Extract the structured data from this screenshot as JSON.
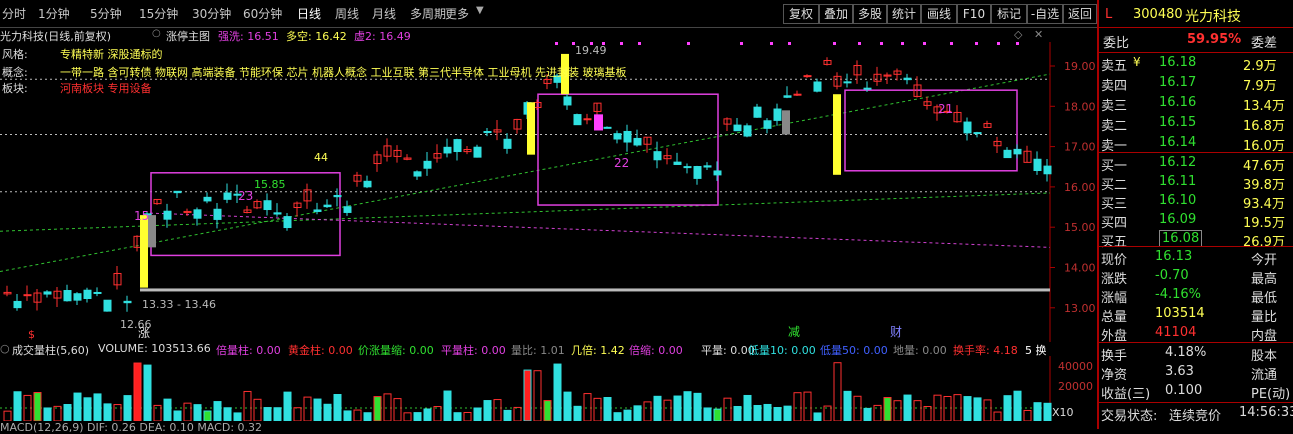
{
  "toolbar": {
    "periods": [
      "分时",
      "1分钟",
      "5分钟",
      "15分钟",
      "30分钟",
      "60分钟",
      "日线",
      "周线",
      "月线",
      "多周期",
      "更多"
    ],
    "active_period": "日线",
    "buttons": [
      "复权",
      "叠加",
      "多股",
      "统计",
      "画线",
      "F10",
      "标记",
      "-自选",
      "返回"
    ]
  },
  "chart_header": {
    "stock": "光力科技(日线,前复权)",
    "indicator": "涨停主图",
    "qiang": "强洗: 16.51",
    "duokong": "多空: 16.42",
    "xu": "虚2: 16.49"
  },
  "stock_info": {
    "style_label": "风格:",
    "style_value": "专精特新 深股通标的",
    "concept_label": "概念:",
    "concept_value": "一带一路 含可转债 物联网 高端装备 节能环保 芯片 机器人概念 工业互联 第三代半导体 工业母机 先进封装 玻璃基板",
    "sector_label": "板块:",
    "sector_value": "河南板块 专用设备"
  },
  "annotations": {
    "high_label": "19.49",
    "range_label": "13.33 - 13.46",
    "low_label": "12.66",
    "num_44": "44",
    "num_23": "23",
    "num_22": "22",
    "num_21": "21",
    "num_15": "15",
    "price_1585": "15.85",
    "mark_s": "$",
    "mark_zhang": "涨",
    "mark_jian": "减",
    "mark_cai": "财"
  },
  "y_axis": [
    "19.00",
    "18.00",
    "17.00",
    "16.00",
    "15.00",
    "14.00",
    "13.00"
  ],
  "volume_header": {
    "name": "成交量柱(5,60)",
    "volume": "VOLUME: 103513.66",
    "beiliang": "倍量柱: 0.00",
    "huangjin": "黄金柱: 0.00",
    "jiazhang": "价涨量缩: 0.00",
    "pingliang": "平量柱: 0.00",
    "liangbi": "量比: 1.01",
    "jibei": "几倍: 1.42",
    "beisuo": "倍缩: 0.00",
    "pingliang2": "平量: 0.00",
    "diliang10": "低量10: 0.00",
    "diliang50": "低量50: 0.00",
    "diliang": "地量: 0.00",
    "huanshou": "换手率: 4.18",
    "five": "5 换"
  },
  "vol_axis": [
    "40000",
    "20000"
  ],
  "vol_unit": "X10",
  "macd_line": "MACD(12,26,9)  DIF: 0.26  DEA: 0.10  MACD: 0.32",
  "quote": {
    "l": "L",
    "code": "300480",
    "name": "光力科技",
    "weibi_label": "委比",
    "weibi_value": "59.95%",
    "weicha_label": "委差",
    "asks": [
      {
        "label": "卖五",
        "price": "16.18",
        "vol": "2.9万"
      },
      {
        "label": "卖四",
        "price": "16.17",
        "vol": "7.9万"
      },
      {
        "label": "卖三",
        "price": "16.16",
        "vol": "13.4万"
      },
      {
        "label": "卖二",
        "price": "16.15",
        "vol": "16.8万"
      },
      {
        "label": "卖一",
        "price": "16.14",
        "vol": "16.0万"
      }
    ],
    "bids": [
      {
        "label": "买一",
        "price": "16.12",
        "vol": "47.6万"
      },
      {
        "label": "买二",
        "price": "16.11",
        "vol": "39.8万"
      },
      {
        "label": "买三",
        "price": "16.10",
        "vol": "93.4万"
      },
      {
        "label": "买四",
        "price": "16.09",
        "vol": "19.5万"
      },
      {
        "label": "买五",
        "price": "16.08",
        "vol": "26.9万"
      }
    ],
    "stats": [
      {
        "l1": "现价",
        "v1": "16.13",
        "l2": "今开",
        "v2": ""
      },
      {
        "l1": "涨跌",
        "v1": "-0.70",
        "l2": "最高",
        "v2": ""
      },
      {
        "l1": "涨幅",
        "v1": "-4.16%",
        "l2": "最低",
        "v2": ""
      },
      {
        "l1": "总量",
        "v1": "103514",
        "l2": "量比",
        "v2": ""
      },
      {
        "l1": "外盘",
        "v1": "41104",
        "l2": "内盘",
        "v2": ""
      }
    ],
    "stats2": [
      {
        "l1": "换手",
        "v1": "4.18%",
        "l2": "股本"
      },
      {
        "l1": "净资",
        "v1": "3.63",
        "l2": "流通"
      },
      {
        "l1": "收益(三)",
        "v1": "0.100",
        "l2": "PE(动)"
      }
    ],
    "trade_state_label": "交易状态:",
    "trade_state": "连续竞价",
    "time": "14:56:33",
    "ask_marker": "¥"
  }
}
